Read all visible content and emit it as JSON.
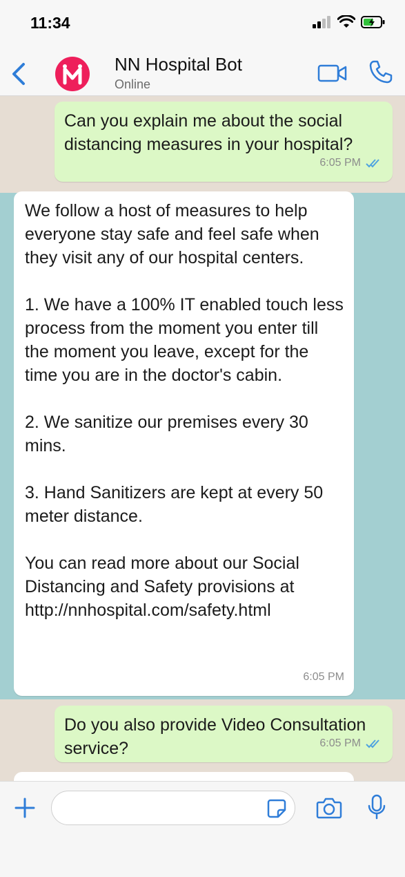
{
  "status_bar": {
    "time": "11:34"
  },
  "header": {
    "contact_name": "NN Hospital Bot",
    "contact_status": "Online"
  },
  "messages": [
    {
      "direction": "out",
      "text": "Can you explain me about the social distancing measures in your hospital?",
      "time": "6:05 PM",
      "read": true
    },
    {
      "direction": "in",
      "text": "We follow a host of measures to help everyone stay safe and feel safe when they visit any of our hospital centers.\n\n1. We have a 100% IT enabled touch less process from the moment you enter till the moment you leave, except for the time you are in the doctor's cabin.\n\n2. We sanitize our premises every 30 mins.\n\n3. Hand Sanitizers are kept at every 50 meter distance.\n\nYou can read more about our Social Distancing and Safety provisions at http://nnhospital.com/safety.html",
      "time": "6:05 PM"
    },
    {
      "direction": "out",
      "text": "Do you also provide Video Consultation service?",
      "time": "6:05 PM",
      "read": true
    }
  ],
  "input": {
    "placeholder": ""
  },
  "colors": {
    "accent": "#2f7dd8",
    "outgoing_bubble": "#dcf8c6",
    "incoming_bubble": "#ffffff",
    "avatar": "#ee1f5b",
    "read_ticks": "#4fa3e0"
  },
  "icons": [
    "back-chevron-icon",
    "bot-logo-icon",
    "video-call-icon",
    "phone-icon",
    "plus-icon",
    "sticker-icon",
    "camera-icon",
    "microphone-icon"
  ]
}
